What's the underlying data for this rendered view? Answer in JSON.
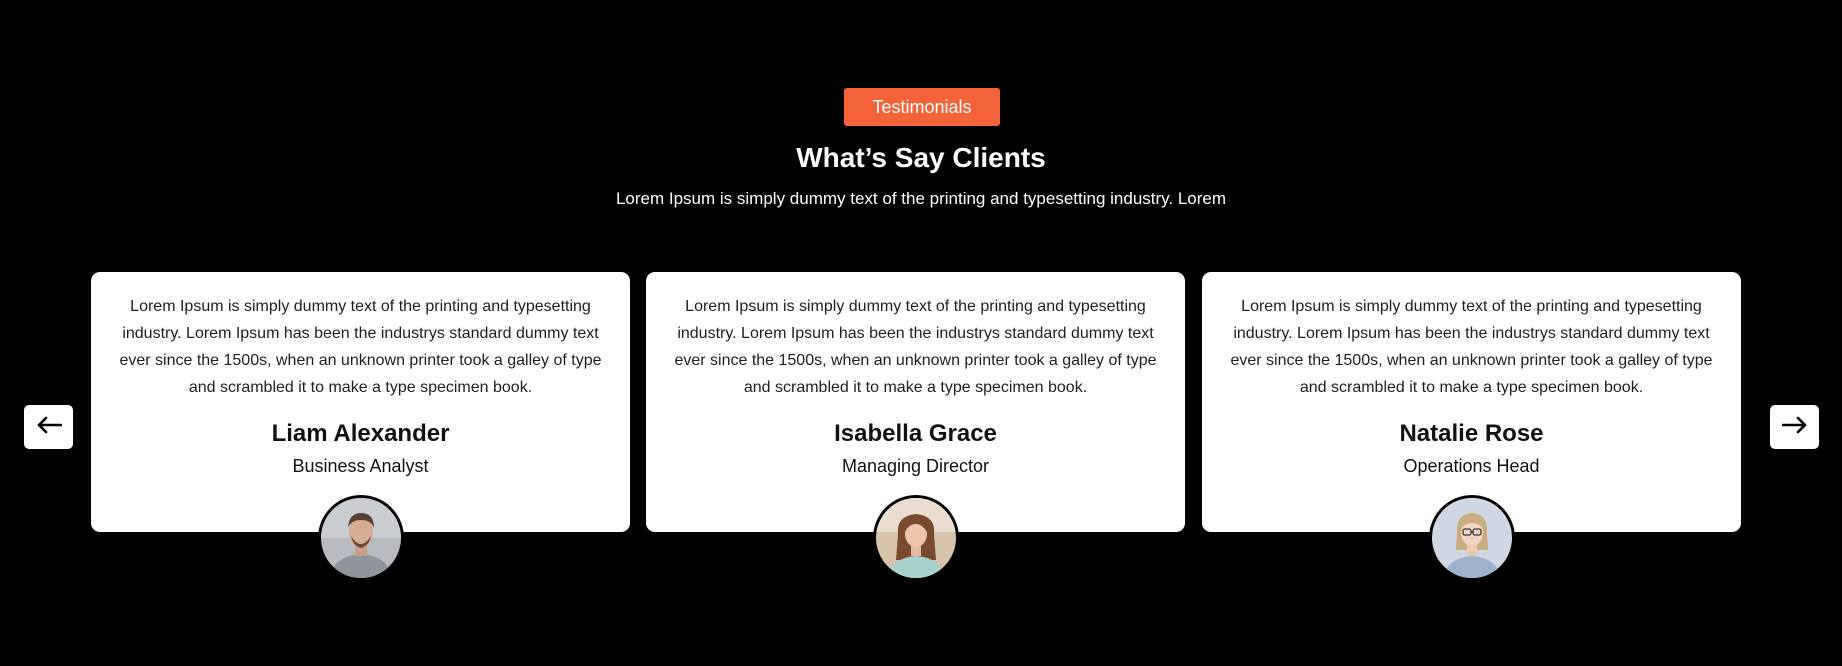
{
  "section": {
    "badge": "Testimonials",
    "heading": "What’s Say Clients",
    "subheading": "Lorem Ipsum is simply dummy text of the printing and typesetting industry. Lorem"
  },
  "testimonials": [
    {
      "text": "Lorem Ipsum is simply dummy text of the printing and typesetting industry. Lorem Ipsum has been the industrys standard dummy text ever since the 1500s, when an unknown printer took a galley of type and scrambled it to make a type specimen book.",
      "name": "Liam Alexander",
      "role": "Business Analyst"
    },
    {
      "text": "Lorem Ipsum is simply dummy text of the printing and typesetting industry. Lorem Ipsum has been the industrys standard dummy text ever since the 1500s, when an unknown printer took a galley of type and scrambled it to make a type specimen book.",
      "name": "Isabella Grace",
      "role": "Managing Director"
    },
    {
      "text": "Lorem Ipsum is simply dummy text of the printing and typesetting industry. Lorem Ipsum has been the industrys standard dummy text ever since the 1500s, when an unknown printer took a galley of type and scrambled it to make a type specimen book.",
      "name": "Natalie Rose",
      "role": "Operations Head"
    }
  ],
  "navigation": {
    "prev_icon": "arrow-left-icon",
    "next_icon": "arrow-right-icon"
  },
  "colors": {
    "background": "#000000",
    "accent": "#f4623a",
    "card": "#ffffff"
  }
}
